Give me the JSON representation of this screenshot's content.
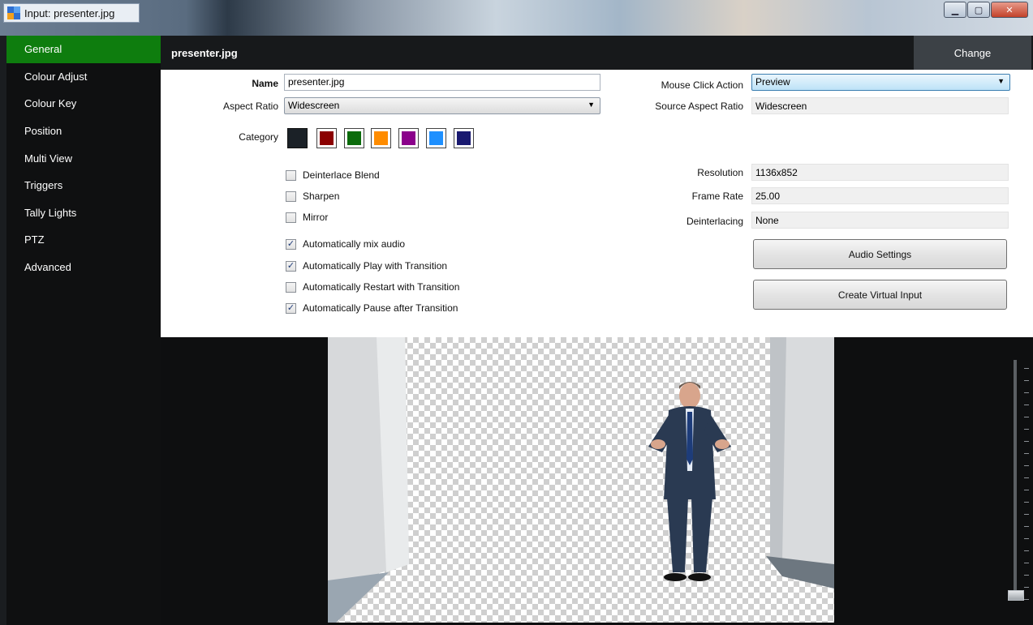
{
  "window": {
    "title": "Input: presenter.jpg",
    "close_glyph": "✕",
    "minimize_glyph": "▁",
    "maximize_glyph": "▢"
  },
  "sidebar": {
    "items": [
      {
        "label": "General",
        "active": true
      },
      {
        "label": "Colour Adjust"
      },
      {
        "label": "Colour Key"
      },
      {
        "label": "Position"
      },
      {
        "label": "Multi View"
      },
      {
        "label": "Triggers"
      },
      {
        "label": "Tally Lights"
      },
      {
        "label": "PTZ"
      },
      {
        "label": "Advanced"
      }
    ]
  },
  "header": {
    "title": "presenter.jpg",
    "change_label": "Change"
  },
  "form": {
    "name_label": "Name",
    "name_value": "presenter.jpg",
    "aspect_label": "Aspect Ratio",
    "aspect_value": "Widescreen",
    "category_label": "Category",
    "categories": [
      "#1b2127",
      "#8b0000",
      "#0b6b0b",
      "#ff8c00",
      "#8b008b",
      "#1e90ff",
      "#191970"
    ],
    "mouse_click_label": "Mouse Click Action",
    "mouse_click_value": "Preview",
    "source_aspect_label": "Source Aspect Ratio",
    "source_aspect_value": "Widescreen",
    "resolution_label": "Resolution",
    "resolution_value": "1136x852",
    "frame_rate_label": "Frame Rate",
    "frame_rate_value": "25.00",
    "deinterlacing_label": "Deinterlacing",
    "deinterlacing_value": "None",
    "audio_settings_label": "Audio Settings",
    "create_virtual_label": "Create Virtual Input",
    "checkboxes": [
      {
        "label": "Deinterlace Blend",
        "checked": false
      },
      {
        "label": "Sharpen",
        "checked": false
      },
      {
        "label": "Mirror",
        "checked": false
      },
      {
        "label": "Automatically mix audio",
        "checked": true
      },
      {
        "label": "Automatically Play with Transition",
        "checked": true
      },
      {
        "label": "Automatically Restart with Transition",
        "checked": false
      },
      {
        "label": "Automatically Pause after Transition",
        "checked": true
      }
    ],
    "check_glyph": "✓"
  },
  "preview": {
    "image": "presenter-on-transparent-background"
  }
}
